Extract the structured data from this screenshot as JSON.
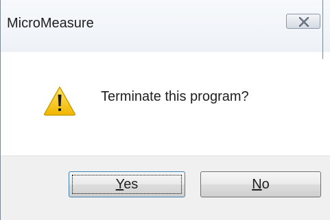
{
  "window": {
    "title": "MicroMeasure",
    "close_icon": "close-x-icon"
  },
  "dialog": {
    "icon": "warning-icon",
    "message": "Terminate this program?"
  },
  "buttons": {
    "yes": {
      "mnemonic": "Y",
      "rest": "es",
      "focused": true
    },
    "no": {
      "mnemonic": "N",
      "rest": "o",
      "focused": false
    }
  },
  "colors": {
    "warning_yellow": "#f5c400",
    "warning_outline": "#c9a000",
    "focus_border": "#3c7fb1"
  }
}
